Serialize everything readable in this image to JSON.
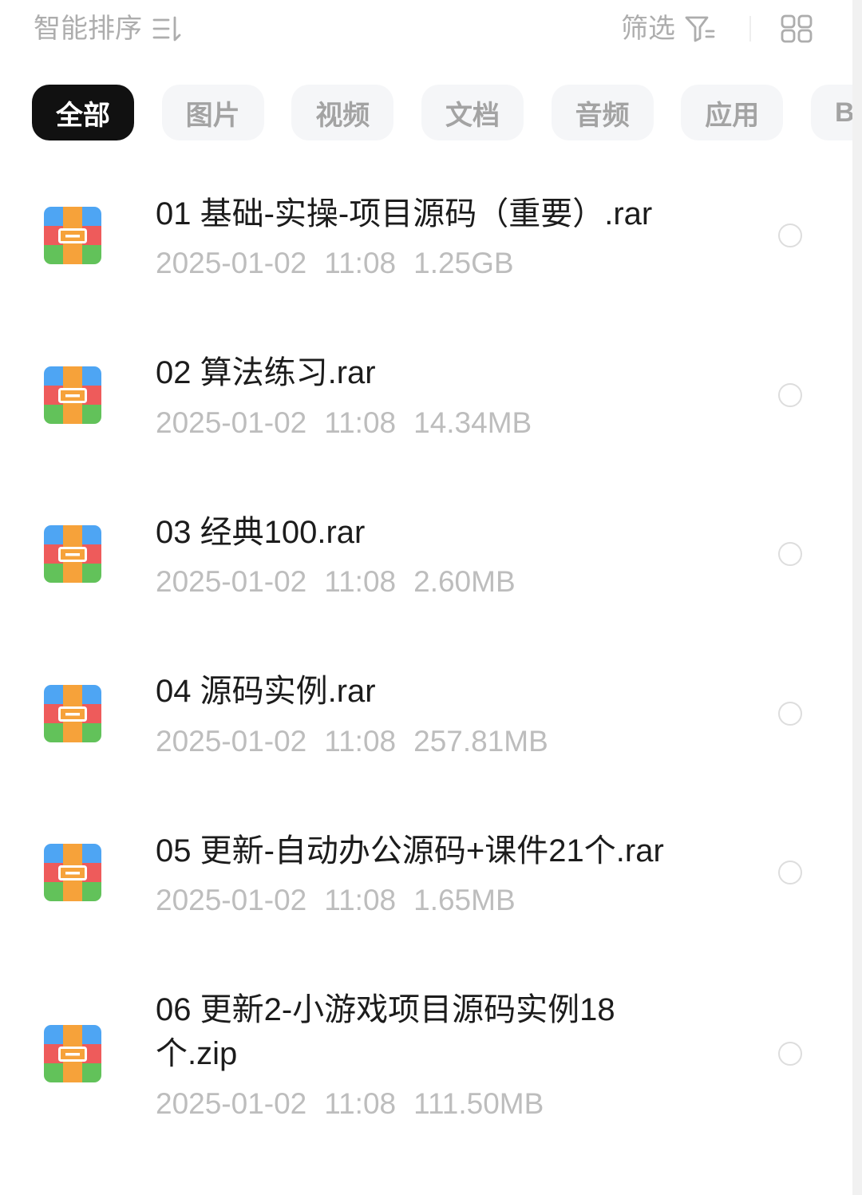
{
  "toolbar": {
    "sort": {
      "label": "智能排序",
      "icon": "sort-icon"
    },
    "filter": {
      "label": "筛选",
      "icon": "filter-icon"
    },
    "view_toggle": {
      "icon": "grid-view-icon"
    }
  },
  "tabs": [
    {
      "label": "全部",
      "active": true
    },
    {
      "label": "图片",
      "active": false
    },
    {
      "label": "视频",
      "active": false
    },
    {
      "label": "文档",
      "active": false
    },
    {
      "label": "音频",
      "active": false
    },
    {
      "label": "应用",
      "active": false
    },
    {
      "label": "B",
      "active": false
    }
  ],
  "files": [
    {
      "name_lines": [
        "01 基础-实操-项目源码（重要）.rar"
      ],
      "date": "2025-01-02",
      "time": "11:08",
      "size": "1.25GB",
      "icon": "archive-icon",
      "checked": false
    },
    {
      "name_lines": [
        "02 算法练习.rar"
      ],
      "date": "2025-01-02",
      "time": "11:08",
      "size": "14.34MB",
      "icon": "archive-icon",
      "checked": false
    },
    {
      "name_lines": [
        "03 经典100.rar"
      ],
      "date": "2025-01-02",
      "time": "11:08",
      "size": "2.60MB",
      "icon": "archive-icon",
      "checked": false
    },
    {
      "name_lines": [
        "04 源码实例.rar"
      ],
      "date": "2025-01-02",
      "time": "11:08",
      "size": "257.81MB",
      "icon": "archive-icon",
      "checked": false
    },
    {
      "name_lines": [
        "05 更新-自动办公源码+课件21个.rar"
      ],
      "date": "2025-01-02",
      "time": "11:08",
      "size": "1.65MB",
      "icon": "archive-icon",
      "checked": false
    },
    {
      "name_lines": [
        "06 更新2-小游戏项目源码实例18",
        "个.zip"
      ],
      "date": "2025-01-02",
      "time": "11:08",
      "size": "111.50MB",
      "icon": "archive-icon",
      "checked": false
    }
  ],
  "colors": {
    "active_tab_bg": "#111111",
    "active_tab_text": "#ffffff",
    "inactive_tab_bg": "#f5f6f8",
    "inactive_tab_text": "#a3a3a3",
    "muted_text": "#adadad",
    "title_text": "#1c1c1c",
    "meta_text": "#bdbdbd",
    "radio_border": "#dddddd",
    "divider": "#eeeeee",
    "edge_strip": "#f1f1f1",
    "archive_blue": "#4ea5f3",
    "archive_red": "#ee5b5b",
    "archive_green": "#62c25a",
    "archive_orange": "#f6a23a"
  }
}
